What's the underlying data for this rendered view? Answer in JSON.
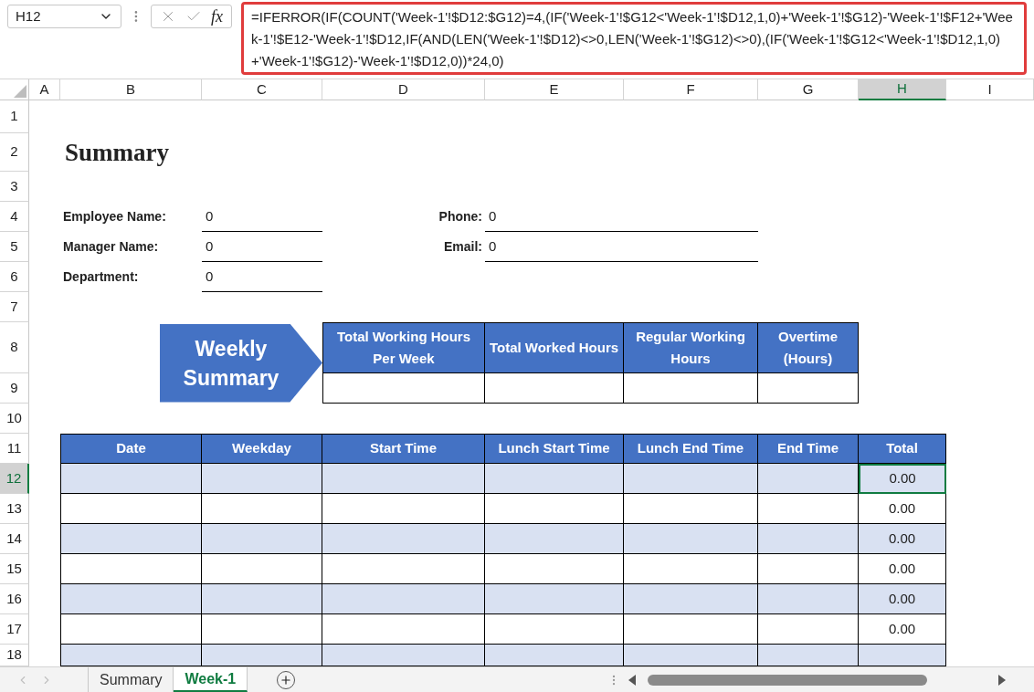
{
  "formula_bar": {
    "name_box": "H12",
    "fx_label": "fx",
    "formula": "=IFERROR(IF(COUNT('Week-1'!$D12:$G12)=4,(IF('Week-1'!$G12<'Week-1'!$D12,1,0)+'Week-1'!$G12)-'Week-1'!$F12+'Week-1'!$E12-'Week-1'!$D12,IF(AND(LEN('Week-1'!$D12)<>0,LEN('Week-1'!$G12)<>0),(IF('Week-1'!$G12<'Week-1'!$D12,1,0)+'Week-1'!$G12)-'Week-1'!$D12,0))*24,0)"
  },
  "column_headers": [
    {
      "label": "A",
      "selected": false
    },
    {
      "label": "B",
      "selected": false
    },
    {
      "label": "C",
      "selected": false
    },
    {
      "label": "D",
      "selected": false
    },
    {
      "label": "E",
      "selected": false
    },
    {
      "label": "F",
      "selected": false
    },
    {
      "label": "G",
      "selected": false
    },
    {
      "label": "H",
      "selected": true
    },
    {
      "label": "I",
      "selected": false
    }
  ],
  "row_headers": [
    {
      "label": "1",
      "selected": false
    },
    {
      "label": "2",
      "selected": false
    },
    {
      "label": "3",
      "selected": false
    },
    {
      "label": "4",
      "selected": false
    },
    {
      "label": "5",
      "selected": false
    },
    {
      "label": "6",
      "selected": false
    },
    {
      "label": "7",
      "selected": false
    },
    {
      "label": "8",
      "selected": false
    },
    {
      "label": "9",
      "selected": false
    },
    {
      "label": "10",
      "selected": false
    },
    {
      "label": "11",
      "selected": false
    },
    {
      "label": "12",
      "selected": true
    },
    {
      "label": "13",
      "selected": false
    },
    {
      "label": "14",
      "selected": false
    },
    {
      "label": "15",
      "selected": false
    },
    {
      "label": "16",
      "selected": false
    },
    {
      "label": "17",
      "selected": false
    },
    {
      "label": "18",
      "selected": false
    }
  ],
  "title": "Summary",
  "left_fields": [
    {
      "label": "Employee Name:",
      "value": "0"
    },
    {
      "label": "Manager Name:",
      "value": "0"
    },
    {
      "label": "Department:",
      "value": "0"
    }
  ],
  "right_fields": [
    {
      "label": "Phone:",
      "value": "0"
    },
    {
      "label": "Email:",
      "value": "0"
    }
  ],
  "weekly_summary": {
    "label": "Weekly Summary",
    "columns": [
      "Total Working Hours Per Week",
      "Total Worked Hours",
      "Regular Working Hours",
      "Overtime (Hours)"
    ]
  },
  "table": {
    "columns": [
      "Date",
      "Weekday",
      "Start Time",
      "Lunch Start Time",
      "Lunch End Time",
      "End Time",
      "Total"
    ],
    "rows": [
      {
        "total": "0.00",
        "selected": true
      },
      {
        "total": "0.00",
        "selected": false
      },
      {
        "total": "0.00",
        "selected": false
      },
      {
        "total": "0.00",
        "selected": false
      },
      {
        "total": "0.00",
        "selected": false
      },
      {
        "total": "0.00",
        "selected": false
      },
      {
        "selected": false
      }
    ]
  },
  "sheet_tabs": [
    {
      "label": "Summary",
      "selected": false
    },
    {
      "label": "Week-1",
      "selected": true
    }
  ]
}
